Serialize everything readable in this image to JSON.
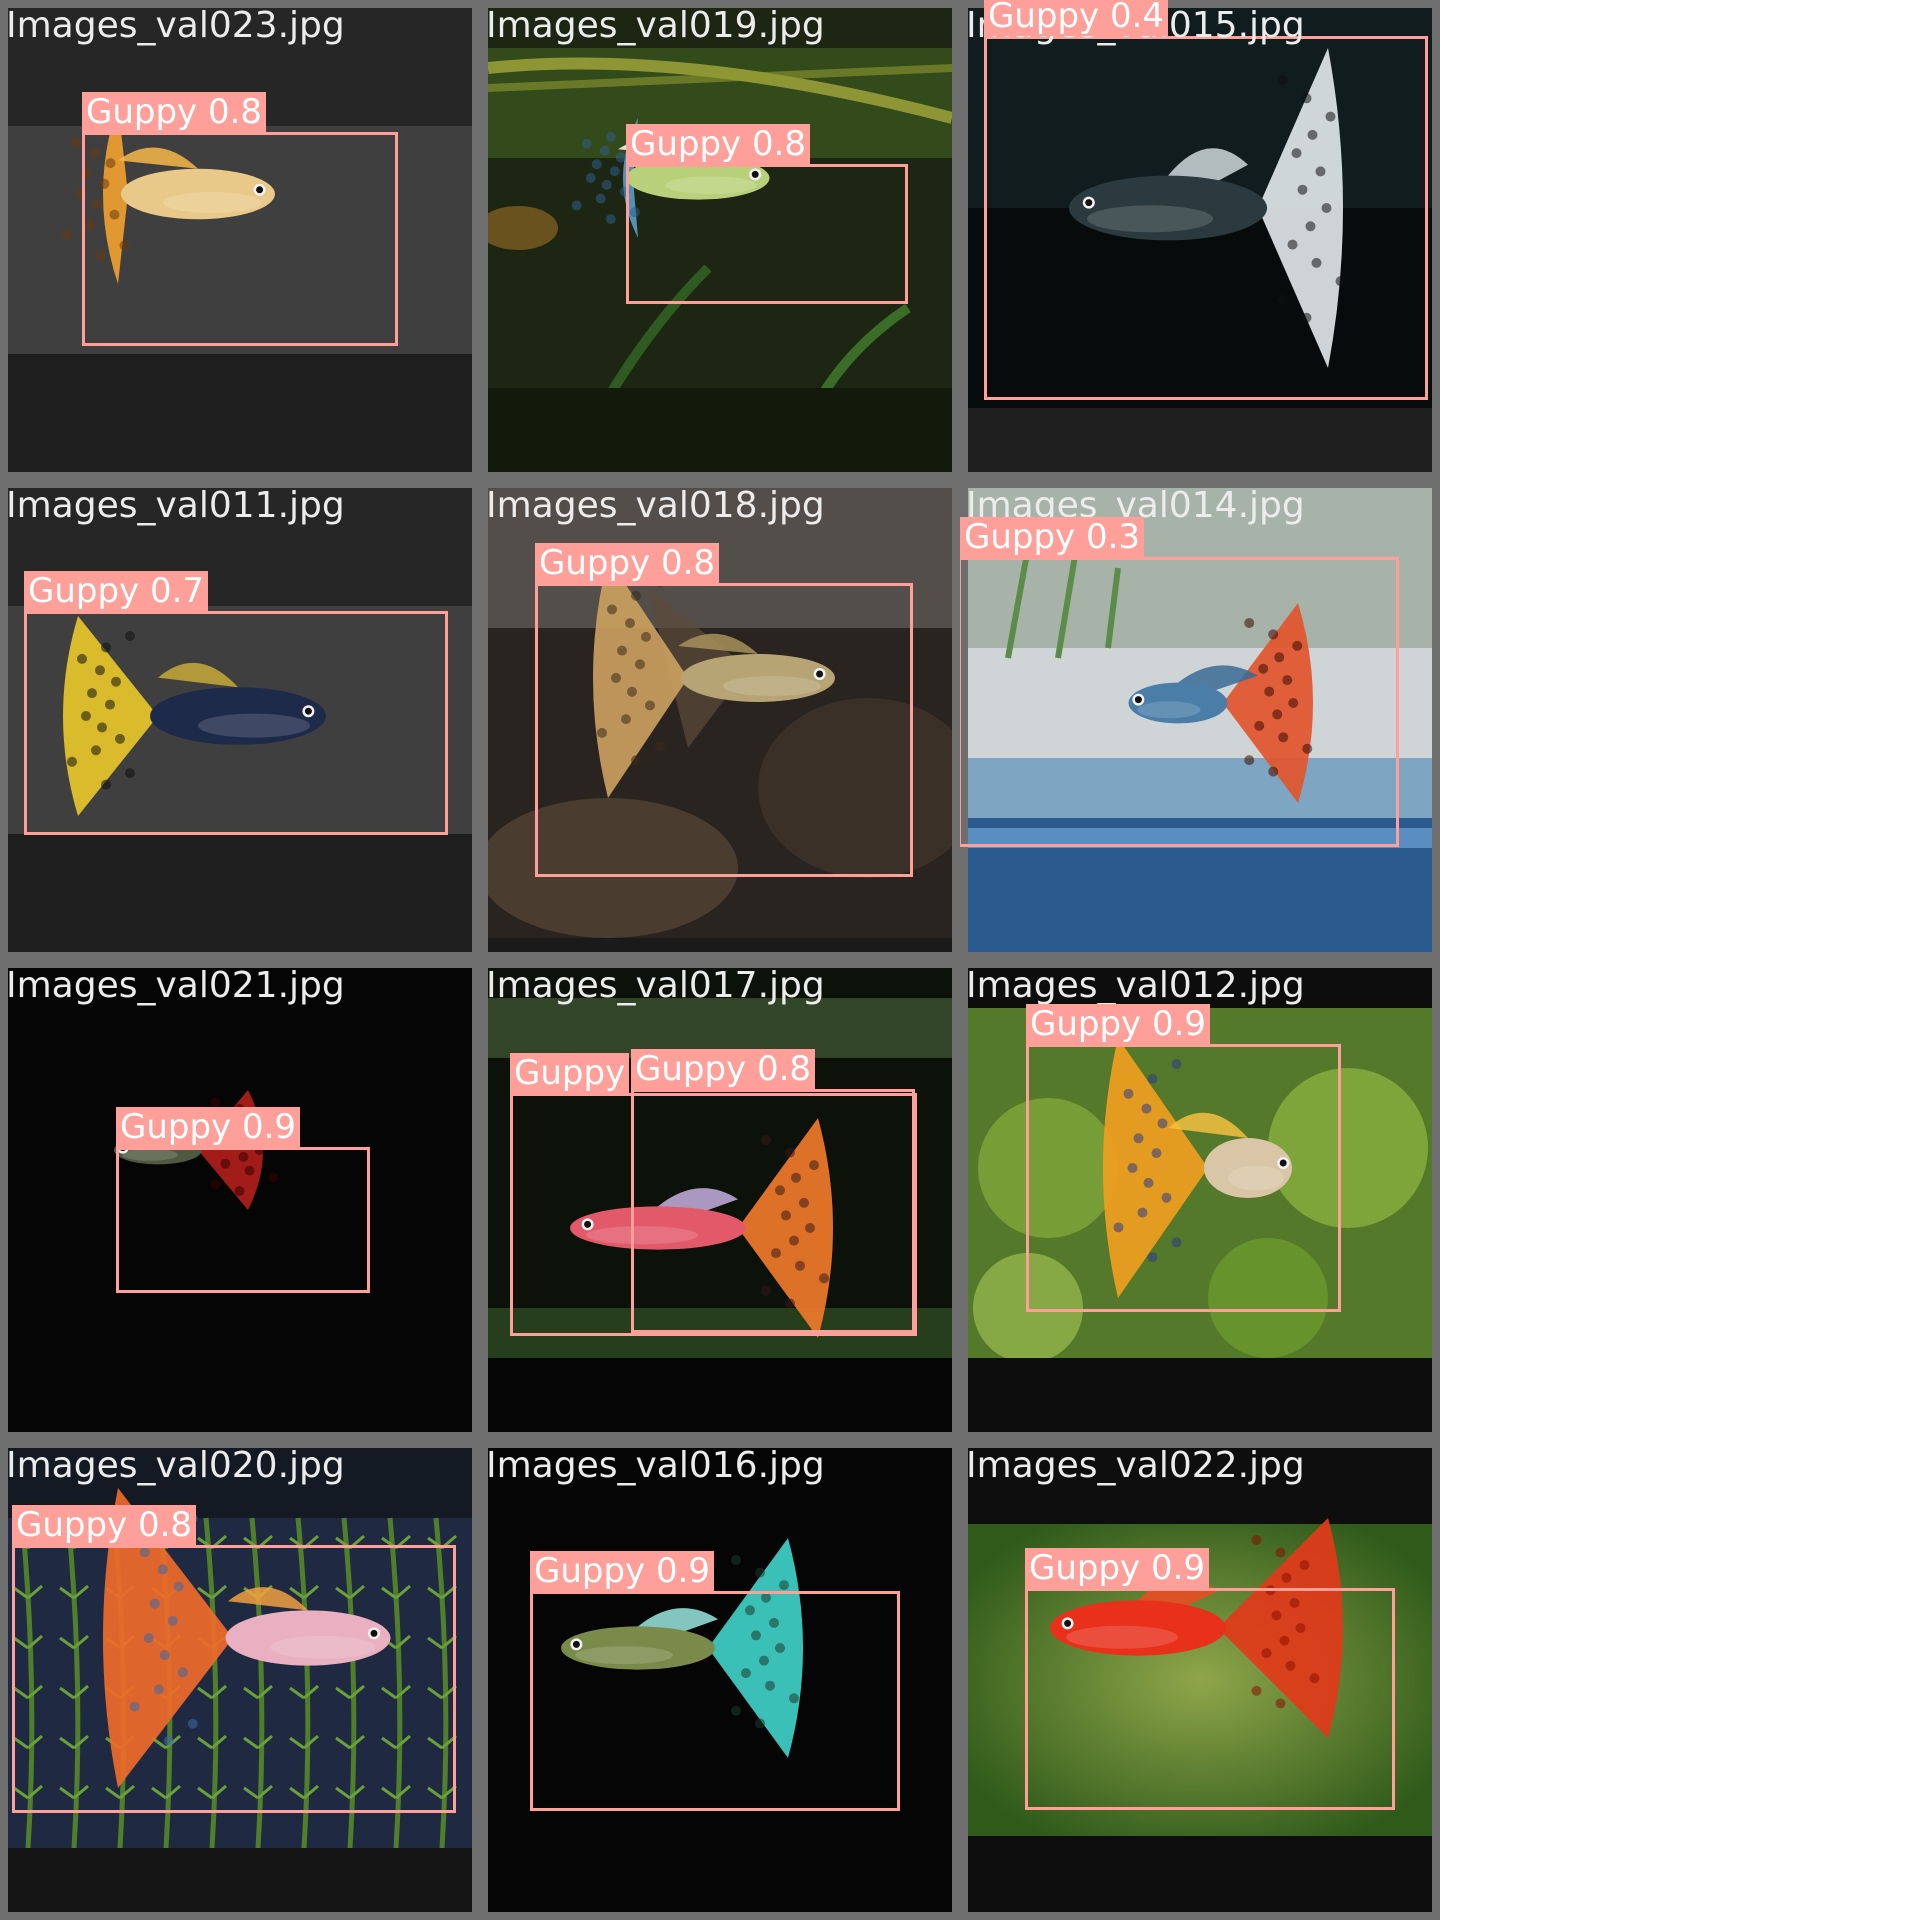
{
  "colors": {
    "box": "#ff9f9a",
    "label_text": "#ffffff",
    "tile_border": "#6e6e6e",
    "filename_text": "#ececec"
  },
  "tiles": [
    {
      "filename": "Images_val023.jpg",
      "scene": "grey-band",
      "fish": "orange",
      "detections": [
        {
          "label": "Guppy 0.8"
        }
      ]
    },
    {
      "filename": "Images_val019.jpg",
      "scene": "plants-dark",
      "fish": "blue",
      "detections": [
        {
          "label": "Guppy 0.8"
        }
      ]
    },
    {
      "filename": "Images_val015.jpg",
      "scene": "dark",
      "fish": "black-white",
      "detections": [
        {
          "label": "Guppy 0.4"
        }
      ]
    },
    {
      "filename": "Images_val011.jpg",
      "scene": "grey-band",
      "fish": "yellow-black",
      "detections": [
        {
          "label": "Guppy 0.7"
        }
      ]
    },
    {
      "filename": "Images_val018.jpg",
      "scene": "rocky",
      "fish": "tan",
      "detections": [
        {
          "label": "Guppy 0.8"
        }
      ]
    },
    {
      "filename": "Images_val014.jpg",
      "scene": "blue-water",
      "fish": "red-blue",
      "detections": [
        {
          "label": "Guppy 0.3"
        }
      ]
    },
    {
      "filename": "Images_val021.jpg",
      "scene": "black",
      "fish": "red",
      "detections": [
        {
          "label": "Guppy 0.9"
        }
      ]
    },
    {
      "filename": "Images_val017.jpg",
      "scene": "dark-green",
      "fish": "orange-lilac",
      "detections": [
        {
          "label": "Guppy"
        },
        {
          "label": "Guppy 0.8"
        }
      ]
    },
    {
      "filename": "Images_val012.jpg",
      "scene": "green-plants",
      "fish": "orange-blue",
      "detections": [
        {
          "label": "Guppy 0.9"
        }
      ]
    },
    {
      "filename": "Images_val020.jpg",
      "scene": "weeds",
      "fish": "orange-rainbow",
      "detections": [
        {
          "label": "Guppy 0.8"
        }
      ]
    },
    {
      "filename": "Images_val016.jpg",
      "scene": "black",
      "fish": "cyan",
      "detections": [
        {
          "label": "Guppy 0.9"
        }
      ]
    },
    {
      "filename": "Images_val022.jpg",
      "scene": "green-gradient",
      "fish": "red-solid",
      "detections": [
        {
          "label": "Guppy 0.9"
        }
      ]
    }
  ]
}
